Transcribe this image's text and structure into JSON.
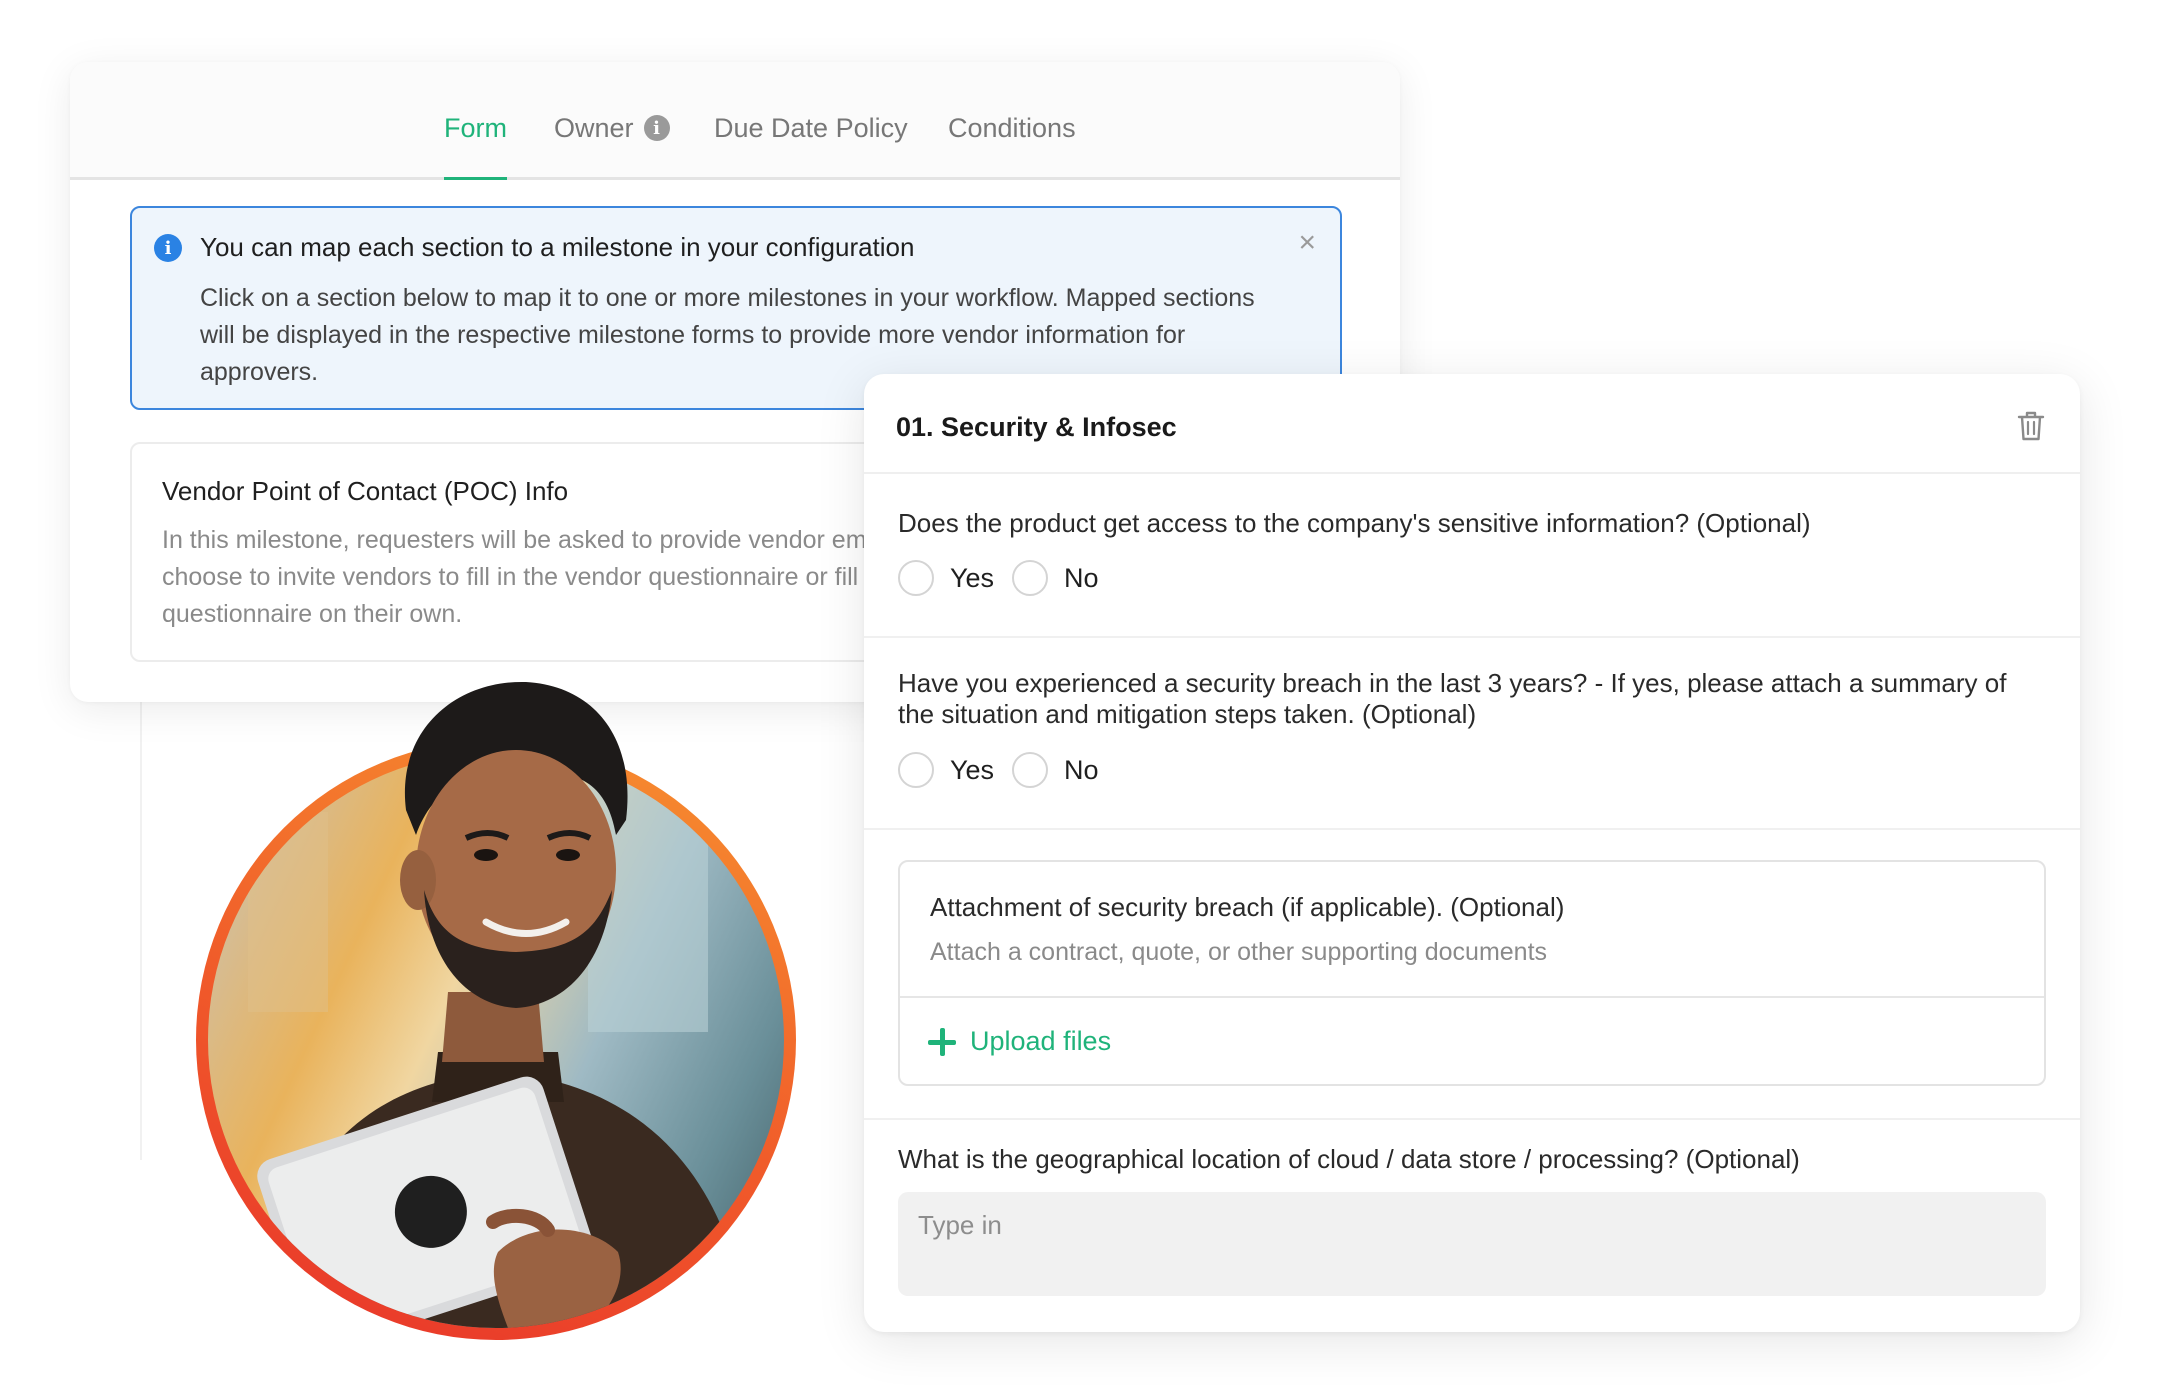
{
  "tabs": [
    {
      "label": "Form",
      "active": true
    },
    {
      "label": "Owner",
      "icon": "info-icon"
    },
    {
      "label": "Due Date Policy"
    },
    {
      "label": "Conditions"
    }
  ],
  "banner": {
    "icon": "info-icon",
    "title": "You can map each section to a milestone in your configuration",
    "body": "Click on a section below to map it to one or more milestones in your workflow. Mapped sections will be displayed in the respective milestone forms to provide more vendor information for approvers.",
    "close": "×"
  },
  "poc": {
    "title": "Vendor Point of Contact (POC) Info",
    "body": "In this milestone, requesters will be asked to provide vendor email if they choose to invite vendors to fill in the vendor questionnaire or fill in the vendor questionnaire on their own."
  },
  "section": {
    "title": "01. Security & Infosec",
    "delete_icon": "trash-icon"
  },
  "questions": {
    "q1": {
      "text": "Does the product get access to the company's sensitive information? (Optional)",
      "yes": "Yes",
      "no": "No"
    },
    "q2": {
      "text": "Have you experienced a security breach in the last 3 years? - If yes, please attach a summary of the situation and mitigation steps taken. (Optional)",
      "yes": "Yes",
      "no": "No"
    },
    "attachment": {
      "title": "Attachment of security breach (if applicable). (Optional)",
      "subtitle": "Attach a contract, quote, or other supporting documents",
      "upload_label": "Upload files"
    },
    "q4": {
      "text": "What is the geographical location of cloud / data store / processing? (Optional)",
      "placeholder": "Type in",
      "value": ""
    }
  },
  "colors": {
    "accent_green": "#1fb37a",
    "info_blue": "#2a82e4",
    "banner_bg": "#eef5fc",
    "ring_orange": "#f05a2a"
  }
}
